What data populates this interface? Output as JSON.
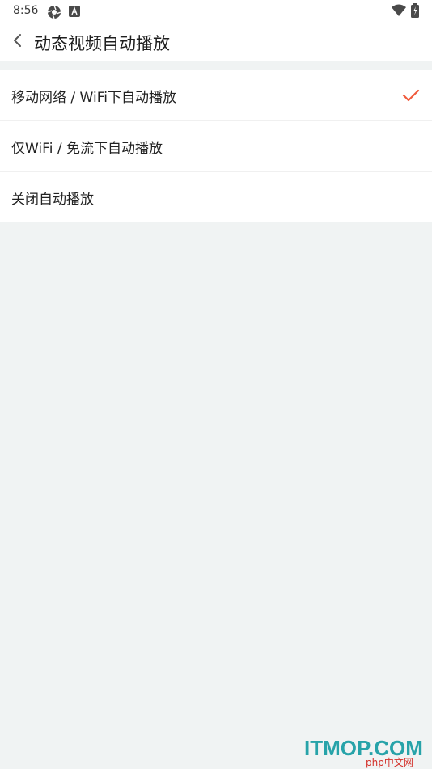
{
  "status_bar": {
    "time": "8:56",
    "left_icons": [
      "aperture-icon",
      "a-box-icon"
    ],
    "right_icons": [
      "wifi-icon",
      "battery-icon"
    ]
  },
  "header": {
    "back_icon": "chevron-left-icon",
    "title": "动态视频自动播放"
  },
  "options": [
    {
      "label": "移动网络 / WiFi下自动播放",
      "selected": true
    },
    {
      "label": "仅WiFi / 免流下自动播放",
      "selected": false
    },
    {
      "label": "关闭自动播放",
      "selected": false
    }
  ],
  "colors": {
    "accent": "#f05a3c",
    "background": "#f0f3f3",
    "surface": "#ffffff"
  },
  "watermark": {
    "main": "ITMOP.COM",
    "sub": "php中文网"
  }
}
